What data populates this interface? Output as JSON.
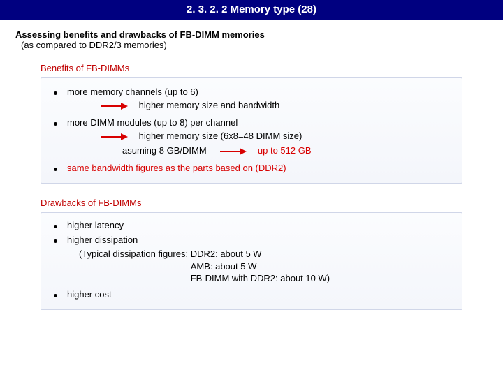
{
  "title": "2. 3. 2. 2 Memory type (28)",
  "heading": {
    "bold": "Assessing benefits and drawbacks of FB-DIMM memories",
    "sub": "(as compared to DDR2/3 memories)"
  },
  "benefits": {
    "title": "Benefits of FB-DIMMs",
    "b1": "more memory channels (up to 6)",
    "b1_arrow": "higher memory size and bandwidth",
    "b2": "more DIMM modules (up to 8) per channel",
    "b2_arrow": "higher memory size (6x8=48 DIMM size)",
    "b2_assume": "asuming 8 GB/DIMM",
    "b2_result": "up to 512 GB",
    "b3": "same bandwidth figures as the parts based on (DDR2)"
  },
  "drawbacks": {
    "title": "Drawbacks of FB-DIMMs",
    "d1": "higher latency",
    "d2": "higher dissipation",
    "dissip_label": "(Typical dissipation figures:",
    "dissip_l1": "DDR2: about 5 W",
    "dissip_l2": "AMB:  about 5 W",
    "dissip_l3": "FB-DIMM with DDR2: about 10 W)",
    "d3": "higher cost"
  }
}
